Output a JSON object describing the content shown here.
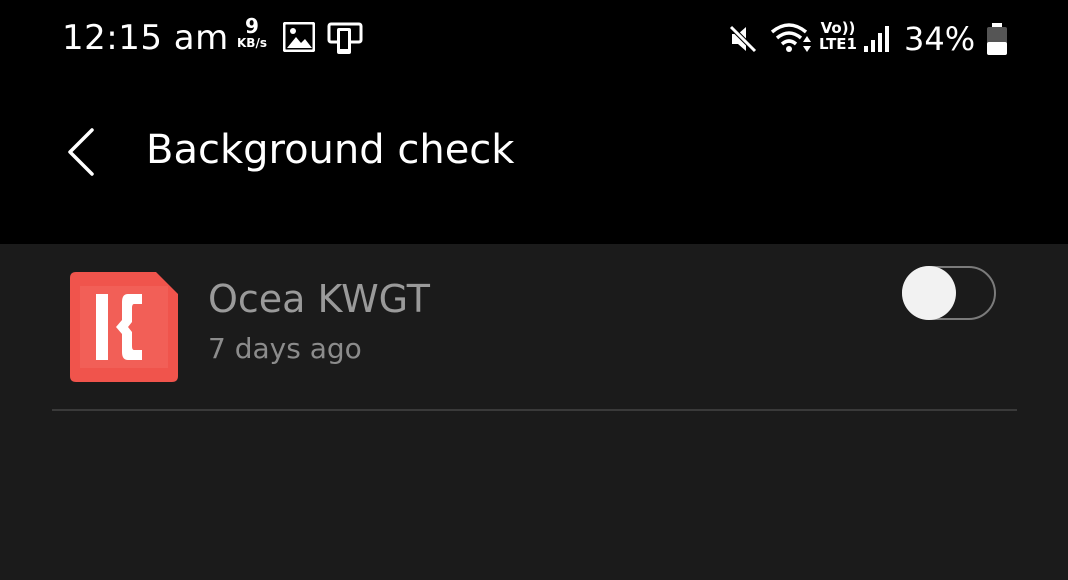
{
  "status_bar": {
    "time": "12:15 am",
    "net_speed_value": "9",
    "net_speed_unit": "KB/s",
    "battery_percent": "34%",
    "icons": [
      "image-icon",
      "screen-mirror-icon",
      "mute-icon",
      "wifi-icon",
      "volte-icon",
      "signal-icon",
      "battery-icon"
    ],
    "network_label_top": "Vo))",
    "network_label_bottom": "LTE1"
  },
  "header": {
    "title": "Background check",
    "back_icon": "chevron-left-icon"
  },
  "apps": [
    {
      "name": "Ocea KWGT",
      "last_used": "7 days ago",
      "toggle_on": false,
      "icon_color": "#f0544c"
    }
  ],
  "colors": {
    "background": "#1b1b1b",
    "header_background": "#000000",
    "accent": "#f0544c"
  }
}
